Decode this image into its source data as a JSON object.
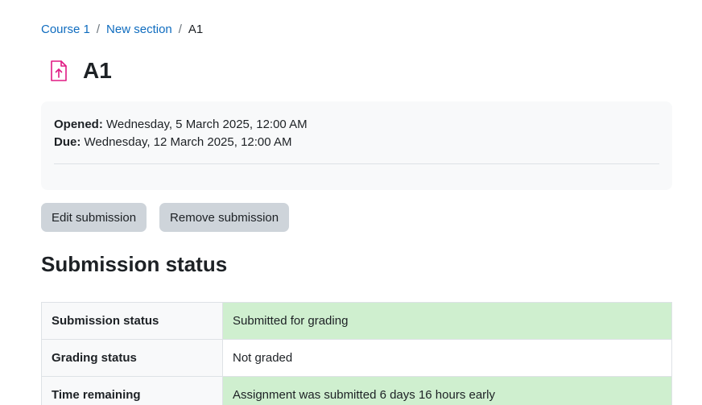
{
  "breadcrumb": {
    "items": [
      {
        "label": "Course 1"
      },
      {
        "label": "New section"
      }
    ],
    "current": "A1",
    "separator": "/"
  },
  "activity": {
    "icon": "file-upload-icon",
    "icon_color": "#e01b84",
    "title": "A1"
  },
  "dates": {
    "opened_label": "Opened:",
    "opened_value": "Wednesday, 5 March 2025, 12:00 AM",
    "due_label": "Due:",
    "due_value": "Wednesday, 12 March 2025, 12:00 AM"
  },
  "actions": {
    "edit_label": "Edit submission",
    "remove_label": "Remove submission"
  },
  "submission": {
    "heading": "Submission status",
    "rows": [
      {
        "label": "Submission status",
        "value": "Submitted for grading",
        "status": "success"
      },
      {
        "label": "Grading status",
        "value": "Not graded",
        "status": "none"
      },
      {
        "label": "Time remaining",
        "value": "Assignment was submitted 6 days 16 hours early",
        "status": "success"
      }
    ]
  },
  "colors": {
    "link": "#0f6cbf",
    "success_bg": "#cfefcf",
    "button_bg": "#ced4da",
    "panel_bg": "#f8f9fa"
  }
}
